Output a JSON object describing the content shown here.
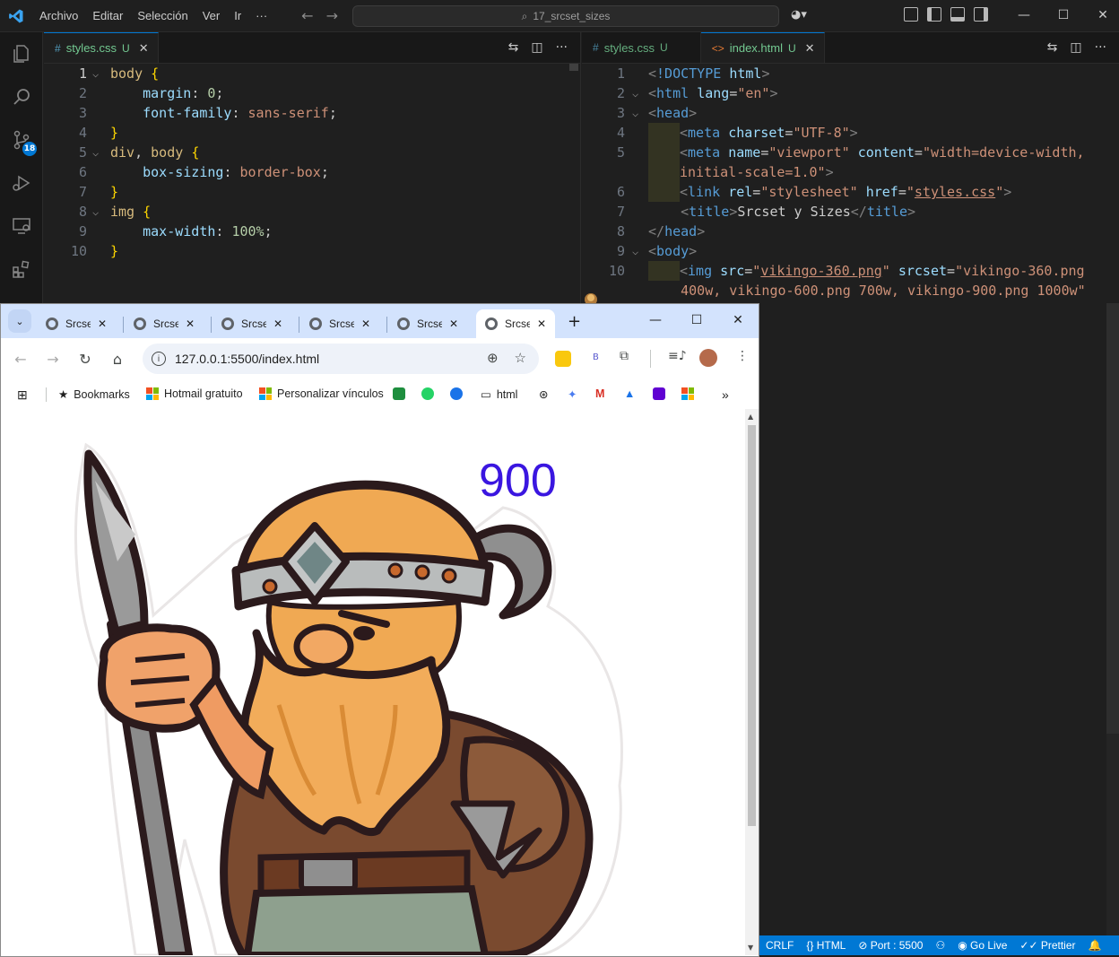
{
  "vscode": {
    "menu": [
      "Archivo",
      "Editar",
      "Selección",
      "Ver",
      "Ir",
      "···"
    ],
    "search_text": "17_srcset_sizes",
    "activity_badge": "18",
    "left_group": {
      "tab": {
        "name": "styles.css",
        "status": "U",
        "close": "✕"
      }
    },
    "right_group": {
      "tabs": [
        {
          "name": "styles.css",
          "status": "U"
        },
        {
          "name": "index.html",
          "status": "U",
          "close": "✕"
        }
      ]
    },
    "css_line_numbers": [
      "1",
      "2",
      "3",
      "4",
      "5",
      "6",
      "7",
      "8",
      "9",
      "10"
    ],
    "html_line_numbers": [
      "1",
      "2",
      "3",
      "4",
      "5",
      "",
      "6",
      "7",
      "8",
      "9",
      "10"
    ],
    "status_bar": [
      {
        "label": "CRLF"
      },
      {
        "label": "{} HTML"
      },
      {
        "label": "⊘ Port : 5500"
      },
      {
        "label": "⚇"
      },
      {
        "label": "◉ Go Live"
      },
      {
        "label": "✓✓ Prettier"
      },
      {
        "label": "🔔"
      }
    ]
  },
  "browser": {
    "tabs": [
      {
        "title": "Srcse"
      },
      {
        "title": "Srcse"
      },
      {
        "title": "Srcse"
      },
      {
        "title": "Srcse"
      },
      {
        "title": "Srcse"
      },
      {
        "title": "Srcse"
      }
    ],
    "url": "127.0.0.1:5500/index.html",
    "extensions": {
      "b_label": "B"
    },
    "bookmarks": [
      {
        "label": "Bookmarks"
      },
      {
        "label": "Hotmail gratuito"
      },
      {
        "label": "Personalizar vínculos"
      },
      {
        "label": "html"
      }
    ],
    "page": {
      "heading": "900"
    }
  },
  "colors": {
    "vscode_bg": "#1f1f1f",
    "accent": "#0078d4",
    "page_label": "#3a16e0"
  }
}
